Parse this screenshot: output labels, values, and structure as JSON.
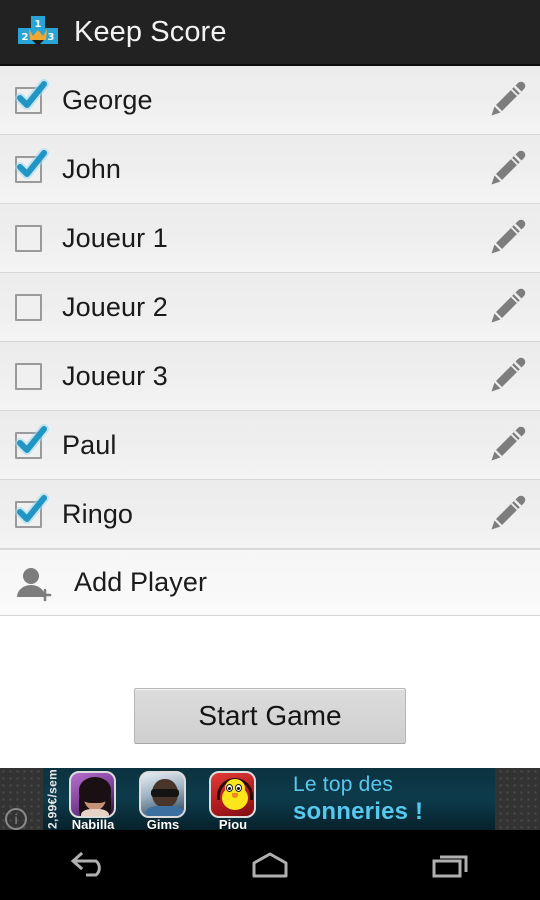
{
  "header": {
    "title": "Keep Score",
    "icon": "podium-trophy-icon"
  },
  "players": [
    {
      "name": "George",
      "checked": true
    },
    {
      "name": "John",
      "checked": true
    },
    {
      "name": "Joueur 1",
      "checked": false
    },
    {
      "name": "Joueur 2",
      "checked": false
    },
    {
      "name": "Joueur 3",
      "checked": false
    },
    {
      "name": "Paul",
      "checked": true
    },
    {
      "name": "Ringo",
      "checked": true
    }
  ],
  "add_player": {
    "label": "Add Player",
    "icon": "person-add-icon"
  },
  "edit_icon": "pencil-icon",
  "start_button": {
    "label": "Start Game"
  },
  "ad": {
    "info_icon": "info-icon",
    "price": "2,99€/sem",
    "thumbs": [
      {
        "caption": "Nabilla"
      },
      {
        "caption": "Gims"
      },
      {
        "caption": "Piou"
      }
    ],
    "line1": "Le top des",
    "line2": "sonneries !"
  },
  "navbar": {
    "back": "back-icon",
    "home": "home-icon",
    "recents": "recents-icon"
  },
  "colors": {
    "accent_blue": "#2196c4",
    "actionbar": "#222222",
    "row_bg": "#eeeeee",
    "ad_teal": "#0d3b4b",
    "ad_text": "#57c8ee"
  }
}
